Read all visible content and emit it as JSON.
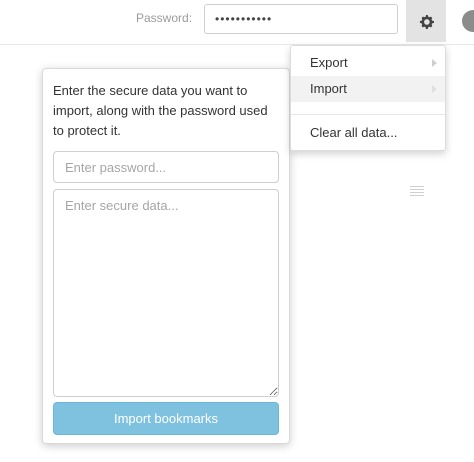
{
  "header": {
    "password_label": "Password:",
    "password_value": "•••••••••••",
    "settings_icon": "gear-icon"
  },
  "menu": {
    "items": [
      {
        "label": "Export",
        "has_submenu": true
      },
      {
        "label": "Import",
        "has_submenu": true
      },
      {
        "label": "Clear all data..."
      }
    ]
  },
  "import_panel": {
    "description": "Enter the secure data you want to import, along with the password used to protect it.",
    "password_placeholder": "Enter password...",
    "data_placeholder": "Enter secure data...",
    "button_label": "Import bookmarks"
  },
  "colors": {
    "button_bg": "#7ec2df",
    "gear_button_bg": "#e3e3e3",
    "menu_highlight": "#f2f2f2"
  }
}
